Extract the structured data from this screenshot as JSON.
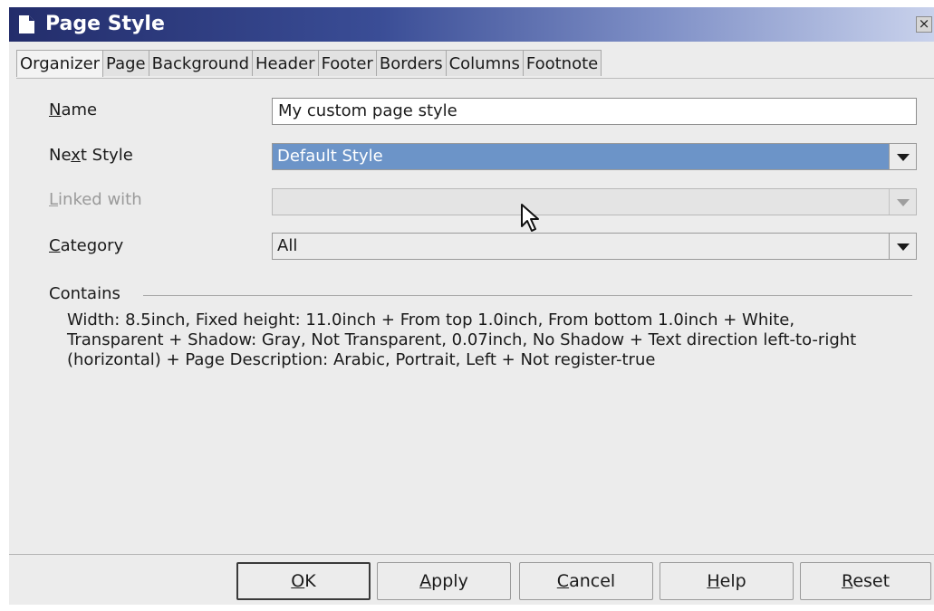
{
  "window": {
    "title": "Page Style",
    "close_glyph": "×"
  },
  "tabs": [
    {
      "label": "Organizer",
      "active": true
    },
    {
      "label": "Page",
      "active": false
    },
    {
      "label": "Background",
      "active": false
    },
    {
      "label": "Header",
      "active": false
    },
    {
      "label": "Footer",
      "active": false
    },
    {
      "label": "Borders",
      "active": false
    },
    {
      "label": "Columns",
      "active": false
    },
    {
      "label": "Footnote",
      "active": false
    }
  ],
  "organizer": {
    "name": {
      "label_mnemonic": "N",
      "label_rest": "ame",
      "value": "My custom page style"
    },
    "next_style": {
      "label_pre": "Ne",
      "label_mnemonic": "x",
      "label_post": "t Style",
      "value": "Default Style"
    },
    "linked_with": {
      "label_mnemonic": "L",
      "label_rest": "inked with",
      "value": "",
      "enabled": false
    },
    "category": {
      "label_mnemonic": "C",
      "label_rest": "ategory",
      "value": "All"
    },
    "contains": {
      "label": "Contains",
      "text": "Width: 8.5inch, Fixed height: 11.0inch + From top 1.0inch, From bottom 1.0inch + White, Transparent + Shadow: Gray, Not Transparent, 0.07inch, No Shadow + Text direction left-to-right (horizontal) + Page Description: Arabic, Portrait, Left + Not register-true"
    }
  },
  "buttons": {
    "ok": {
      "mnemonic": "O",
      "rest": "K"
    },
    "apply": {
      "mnemonic": "A",
      "rest": "pply"
    },
    "cancel": {
      "mnemonic": "C",
      "rest": "ancel"
    },
    "help": {
      "mnemonic": "H",
      "rest": "elp"
    },
    "reset": {
      "mnemonic": "R",
      "rest": "eset"
    }
  },
  "icons": {
    "title": "document-icon",
    "close": "close-icon",
    "dropdown": "chevron-down-icon",
    "pointer": "mouse-pointer-icon"
  },
  "colors": {
    "titlebar_start": "#232d6b",
    "selection": "#6c94c8",
    "dialog_bg": "#ececec"
  }
}
